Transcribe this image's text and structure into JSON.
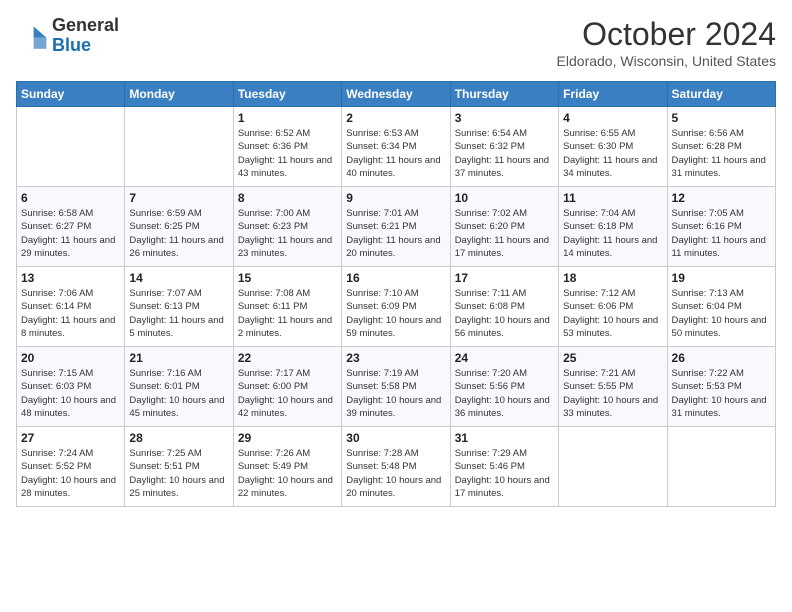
{
  "header": {
    "logo_line1": "General",
    "logo_line2": "Blue",
    "month": "October 2024",
    "location": "Eldorado, Wisconsin, United States"
  },
  "weekdays": [
    "Sunday",
    "Monday",
    "Tuesday",
    "Wednesday",
    "Thursday",
    "Friday",
    "Saturday"
  ],
  "weeks": [
    [
      {
        "day": "",
        "info": ""
      },
      {
        "day": "",
        "info": ""
      },
      {
        "day": "1",
        "info": "Sunrise: 6:52 AM\nSunset: 6:36 PM\nDaylight: 11 hours and 43 minutes."
      },
      {
        "day": "2",
        "info": "Sunrise: 6:53 AM\nSunset: 6:34 PM\nDaylight: 11 hours and 40 minutes."
      },
      {
        "day": "3",
        "info": "Sunrise: 6:54 AM\nSunset: 6:32 PM\nDaylight: 11 hours and 37 minutes."
      },
      {
        "day": "4",
        "info": "Sunrise: 6:55 AM\nSunset: 6:30 PM\nDaylight: 11 hours and 34 minutes."
      },
      {
        "day": "5",
        "info": "Sunrise: 6:56 AM\nSunset: 6:28 PM\nDaylight: 11 hours and 31 minutes."
      }
    ],
    [
      {
        "day": "6",
        "info": "Sunrise: 6:58 AM\nSunset: 6:27 PM\nDaylight: 11 hours and 29 minutes."
      },
      {
        "day": "7",
        "info": "Sunrise: 6:59 AM\nSunset: 6:25 PM\nDaylight: 11 hours and 26 minutes."
      },
      {
        "day": "8",
        "info": "Sunrise: 7:00 AM\nSunset: 6:23 PM\nDaylight: 11 hours and 23 minutes."
      },
      {
        "day": "9",
        "info": "Sunrise: 7:01 AM\nSunset: 6:21 PM\nDaylight: 11 hours and 20 minutes."
      },
      {
        "day": "10",
        "info": "Sunrise: 7:02 AM\nSunset: 6:20 PM\nDaylight: 11 hours and 17 minutes."
      },
      {
        "day": "11",
        "info": "Sunrise: 7:04 AM\nSunset: 6:18 PM\nDaylight: 11 hours and 14 minutes."
      },
      {
        "day": "12",
        "info": "Sunrise: 7:05 AM\nSunset: 6:16 PM\nDaylight: 11 hours and 11 minutes."
      }
    ],
    [
      {
        "day": "13",
        "info": "Sunrise: 7:06 AM\nSunset: 6:14 PM\nDaylight: 11 hours and 8 minutes."
      },
      {
        "day": "14",
        "info": "Sunrise: 7:07 AM\nSunset: 6:13 PM\nDaylight: 11 hours and 5 minutes."
      },
      {
        "day": "15",
        "info": "Sunrise: 7:08 AM\nSunset: 6:11 PM\nDaylight: 11 hours and 2 minutes."
      },
      {
        "day": "16",
        "info": "Sunrise: 7:10 AM\nSunset: 6:09 PM\nDaylight: 10 hours and 59 minutes."
      },
      {
        "day": "17",
        "info": "Sunrise: 7:11 AM\nSunset: 6:08 PM\nDaylight: 10 hours and 56 minutes."
      },
      {
        "day": "18",
        "info": "Sunrise: 7:12 AM\nSunset: 6:06 PM\nDaylight: 10 hours and 53 minutes."
      },
      {
        "day": "19",
        "info": "Sunrise: 7:13 AM\nSunset: 6:04 PM\nDaylight: 10 hours and 50 minutes."
      }
    ],
    [
      {
        "day": "20",
        "info": "Sunrise: 7:15 AM\nSunset: 6:03 PM\nDaylight: 10 hours and 48 minutes."
      },
      {
        "day": "21",
        "info": "Sunrise: 7:16 AM\nSunset: 6:01 PM\nDaylight: 10 hours and 45 minutes."
      },
      {
        "day": "22",
        "info": "Sunrise: 7:17 AM\nSunset: 6:00 PM\nDaylight: 10 hours and 42 minutes."
      },
      {
        "day": "23",
        "info": "Sunrise: 7:19 AM\nSunset: 5:58 PM\nDaylight: 10 hours and 39 minutes."
      },
      {
        "day": "24",
        "info": "Sunrise: 7:20 AM\nSunset: 5:56 PM\nDaylight: 10 hours and 36 minutes."
      },
      {
        "day": "25",
        "info": "Sunrise: 7:21 AM\nSunset: 5:55 PM\nDaylight: 10 hours and 33 minutes."
      },
      {
        "day": "26",
        "info": "Sunrise: 7:22 AM\nSunset: 5:53 PM\nDaylight: 10 hours and 31 minutes."
      }
    ],
    [
      {
        "day": "27",
        "info": "Sunrise: 7:24 AM\nSunset: 5:52 PM\nDaylight: 10 hours and 28 minutes."
      },
      {
        "day": "28",
        "info": "Sunrise: 7:25 AM\nSunset: 5:51 PM\nDaylight: 10 hours and 25 minutes."
      },
      {
        "day": "29",
        "info": "Sunrise: 7:26 AM\nSunset: 5:49 PM\nDaylight: 10 hours and 22 minutes."
      },
      {
        "day": "30",
        "info": "Sunrise: 7:28 AM\nSunset: 5:48 PM\nDaylight: 10 hours and 20 minutes."
      },
      {
        "day": "31",
        "info": "Sunrise: 7:29 AM\nSunset: 5:46 PM\nDaylight: 10 hours and 17 minutes."
      },
      {
        "day": "",
        "info": ""
      },
      {
        "day": "",
        "info": ""
      }
    ]
  ]
}
